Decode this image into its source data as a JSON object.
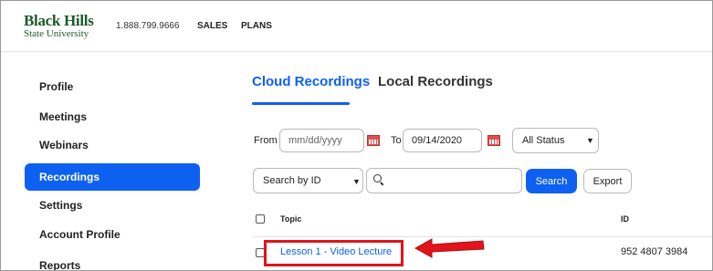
{
  "header": {
    "logo_line1": "Black Hills",
    "logo_line2": "State University",
    "phone": "1.888.799.9666",
    "nav": [
      "SALES",
      "PLANS"
    ]
  },
  "sidebar": {
    "items": [
      {
        "label": "Profile",
        "active": false
      },
      {
        "label": "Meetings",
        "active": false
      },
      {
        "label": "Webinars",
        "active": false
      },
      {
        "label": "Recordings",
        "active": true
      },
      {
        "label": "Settings",
        "active": false
      },
      {
        "label": "Account Profile",
        "active": false
      },
      {
        "label": "Reports",
        "active": false
      }
    ]
  },
  "tabs": [
    {
      "label": "Cloud Recordings",
      "active": true
    },
    {
      "label": "Local Recordings",
      "active": false
    }
  ],
  "filters": {
    "from_label": "From",
    "from_placeholder": "mm/dd/yyyy",
    "to_label": "To",
    "to_value": "09/14/2020",
    "status_selected": "All Status",
    "search_type_selected": "Search by ID",
    "search_value": "",
    "search_button": "Search",
    "export_button": "Export"
  },
  "table": {
    "columns": [
      "Topic",
      "ID"
    ],
    "rows": [
      {
        "topic": "Lesson 1 - Video Lecture",
        "id": "952 4807 3984"
      }
    ]
  },
  "colors": {
    "accent": "#0e60f0",
    "highlight": "#e1141b",
    "logo": "#1d5a2b"
  },
  "icons": [
    "calendar-icon",
    "chevron-down-icon",
    "search-icon",
    "arrow-left-icon"
  ]
}
